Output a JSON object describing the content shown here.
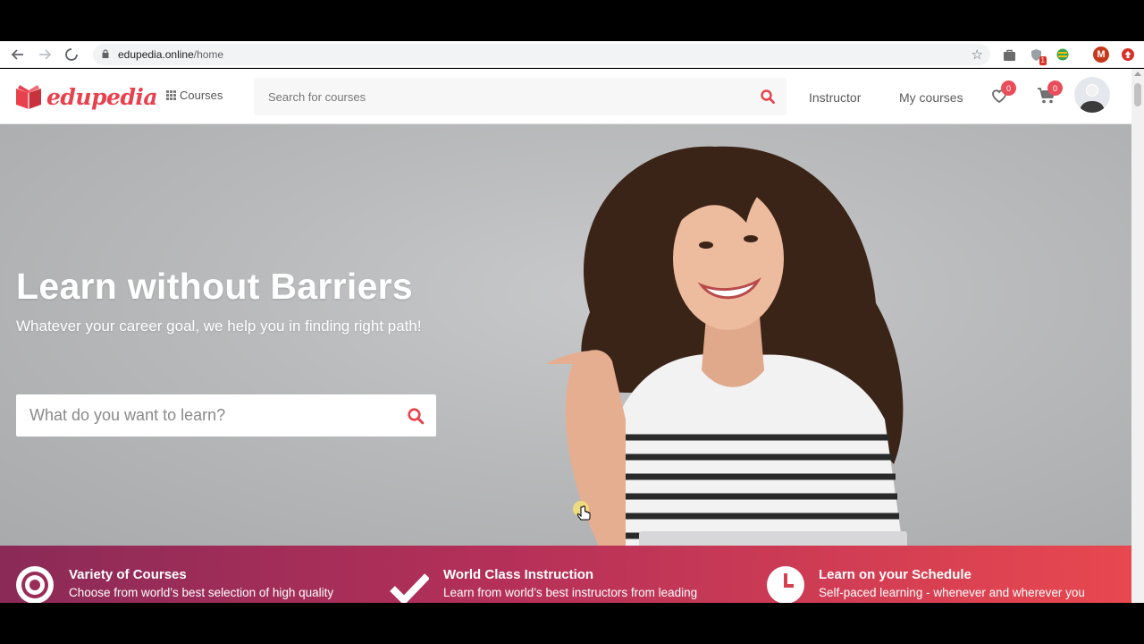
{
  "browser": {
    "url_host": "edupedia.online",
    "url_path": "/home",
    "profile_initial": "M",
    "ext_badge": "1",
    "icons": [
      "back-arrow-icon",
      "forward-arrow-icon",
      "loading-stop-icon",
      "lock-icon",
      "bookmark-star-icon"
    ]
  },
  "header": {
    "logo_text": "edupedia",
    "courses_label": "Courses",
    "search_placeholder": "Search for courses",
    "instructor_label": "Instructor",
    "my_courses_label": "My courses",
    "wishlist_count": "0",
    "cart_count": "0"
  },
  "hero": {
    "title": "Learn without Barriers",
    "subtitle": "Whatever your career goal, we help you in finding right path!",
    "search_placeholder": "What do you want to learn?"
  },
  "features": [
    {
      "title": "Variety of Courses",
      "desc": "Choose from world’s best selection of high quality",
      "icon": "target-icon"
    },
    {
      "title": "World Class Instruction",
      "desc": "Learn from world’s best instructors from leading",
      "icon": "checkmark-icon"
    },
    {
      "title": "Learn on your Schedule",
      "desc": "Self-paced learning - whenever and wherever you",
      "icon": "clock-icon"
    }
  ],
  "colors": {
    "brand": "#e8414d",
    "feature_gradient_start": "#8b2a57",
    "feature_gradient_end": "#e8484f"
  }
}
